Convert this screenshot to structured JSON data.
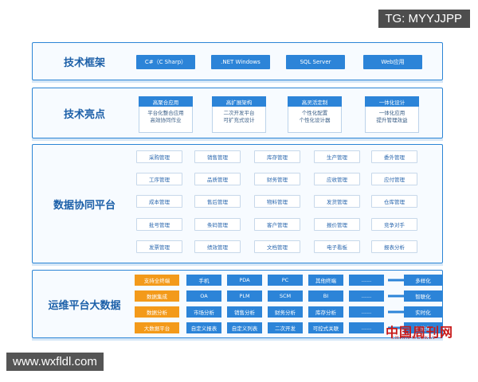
{
  "watermarks": {
    "top_right": "TG: MYYJJPP",
    "bottom_left": "www.wxfldl.com",
    "logo_cn": "中国周刊网",
    "logo_en": "CHINA WEEKLY"
  },
  "sections": {
    "tech_framework": {
      "title": "技术框架",
      "items": [
        "C#（C Sharp）",
        ".NET Windows",
        "SQL Server",
        "Web应用"
      ]
    },
    "tech_highlights": {
      "title": "技术亮点",
      "boxes": [
        {
          "head": "高聚合应用",
          "line1": "平台化整合应用",
          "line2": "高效协同作业"
        },
        {
          "head": "高扩展架构",
          "line1": "二次开发平台",
          "line2": "可扩充式设计"
        },
        {
          "head": "高灵活定制",
          "line1": "个性化配置",
          "line2": "个性化设计器"
        },
        {
          "head": "一体化设计",
          "line1": "一体化应用",
          "line2": "提升管理效益"
        }
      ]
    },
    "data_platform": {
      "title": "数据协同平台",
      "rows": [
        [
          "采购管理",
          "销售管理",
          "库存管理",
          "生产管理",
          "委外管理"
        ],
        [
          "工序管理",
          "品质管理",
          "财务管理",
          "应收管理",
          "应付管理"
        ],
        [
          "成本管理",
          "售后管理",
          "物料管理",
          "发货管理",
          "仓库管理"
        ],
        [
          "批号管理",
          "条码管理",
          "客户管理",
          "报价管理",
          "竞争对手"
        ],
        [
          "发票管理",
          "绩效管理",
          "文档管理",
          "电子看板",
          "报表分析"
        ]
      ]
    },
    "ops_platform": {
      "title": "运维平台大数据",
      "rows": [
        {
          "label": "支持全终端",
          "items": [
            "手机",
            "PDA",
            "PC",
            "其他终端",
            "......"
          ],
          "out": "多样化"
        },
        {
          "label": "数据集成",
          "items": [
            "OA",
            "PLM",
            "SCM",
            "BI",
            "......"
          ],
          "out": "智联化"
        },
        {
          "label": "数据分析",
          "items": [
            "市场分析",
            "销售分析",
            "财务分析",
            "库存分析",
            "......"
          ],
          "out": "实时化"
        },
        {
          "label": "大数据平台",
          "items": [
            "自定义报表",
            "自定义列表",
            "二次开发",
            "可控式关联",
            "......"
          ],
          "out": "智能化"
        }
      ]
    }
  }
}
